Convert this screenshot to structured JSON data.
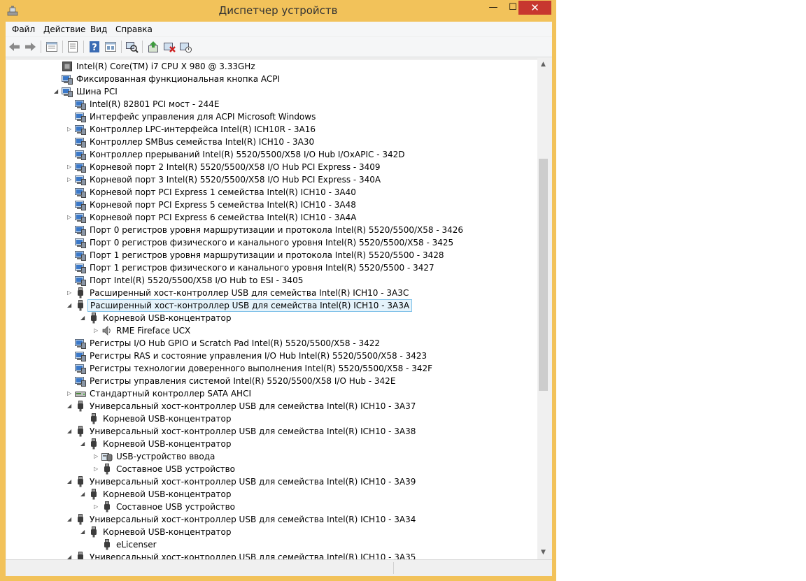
{
  "window": {
    "title": "Диспетчер устройств",
    "frame_color": "#f2c25a",
    "close_color": "#c7372f",
    "buttons": {
      "minimize": "—",
      "maximize": "☐",
      "close": "✕"
    }
  },
  "menu": [
    "Файл",
    "Действие",
    "Вид",
    "Справка"
  ],
  "toolbar": [
    "back-icon",
    "forward-icon",
    "properties-sheet-icon",
    "list-view-icon",
    "help-icon",
    "show-hidden-icon",
    "scan-hardware-icon",
    "update-driver-icon",
    "disable-device-icon",
    "uninstall-device-icon"
  ],
  "tree": [
    {
      "label": "Intel(R) Core(TM) i7 CPU       X 980  @ 3.33GHz",
      "level": 0,
      "expander": "none",
      "icon": "cpu"
    },
    {
      "label": "Фиксированная функциональная кнопка ACPI",
      "level": 0,
      "expander": "none",
      "icon": "system"
    },
    {
      "label": "Шина PCI",
      "level": 0,
      "expander": "open",
      "icon": "system"
    },
    {
      "label": "Intel(R) 82801 PCI мост - 244E",
      "level": 1,
      "expander": "none",
      "icon": "system"
    },
    {
      "label": "Интерфейс управления для ACPI Microsoft Windows",
      "level": 1,
      "expander": "none",
      "icon": "system"
    },
    {
      "label": "Контроллер LPC-интерфейса Intel(R) ICH10R - 3A16",
      "level": 1,
      "expander": "closed",
      "icon": "system"
    },
    {
      "label": "Контроллер SMBus семейства Intel(R) ICH10 - 3A30",
      "level": 1,
      "expander": "none",
      "icon": "system"
    },
    {
      "label": "Контроллер прерываний Intel(R) 5520/5500/X58 I/O Hub I/OxAPIC - 342D",
      "level": 1,
      "expander": "none",
      "icon": "system"
    },
    {
      "label": "Корневой порт 2 Intel(R) 5520/5500/X58 I/O Hub PCI Express - 3409",
      "level": 1,
      "expander": "closed",
      "icon": "system"
    },
    {
      "label": "Корневой порт 3 Intel(R) 5520/5500/X58 I/O Hub PCI Express - 340A",
      "level": 1,
      "expander": "closed",
      "icon": "system"
    },
    {
      "label": "Корневой порт PCI Express 1 семейства Intel(R) ICH10 - 3A40",
      "level": 1,
      "expander": "none",
      "icon": "system"
    },
    {
      "label": "Корневой порт PCI Express 5 семейства Intel(R) ICH10 - 3A48",
      "level": 1,
      "expander": "none",
      "icon": "system"
    },
    {
      "label": "Корневой порт PCI Express 6 семейства Intel(R) ICH10 - 3A4A",
      "level": 1,
      "expander": "closed",
      "icon": "system"
    },
    {
      "label": "Порт 0 регистров уровня маршрутизации и протокола Intel(R) 5520/5500/X58 - 3426",
      "level": 1,
      "expander": "none",
      "icon": "system"
    },
    {
      "label": "Порт 0 регистров физического и канального уровня Intel(R) 5520/5500/X58 - 3425",
      "level": 1,
      "expander": "none",
      "icon": "system"
    },
    {
      "label": "Порт 1 регистров уровня маршрутизации и протокола Intel(R) 5520/5500 - 3428",
      "level": 1,
      "expander": "none",
      "icon": "system"
    },
    {
      "label": "Порт 1 регистров физического и канального уровня Intel(R) 5520/5500 - 3427",
      "level": 1,
      "expander": "none",
      "icon": "system"
    },
    {
      "label": "Порт Intel(R) 5520/5500/X58 I/O Hub to ESI - 3405",
      "level": 1,
      "expander": "none",
      "icon": "system"
    },
    {
      "label": "Расширенный хост-контроллер USB для семейства Intel(R) ICH10 - 3A3C",
      "level": 1,
      "expander": "closed",
      "icon": "usb"
    },
    {
      "label": "Расширенный хост-контроллер USB для семейства Intel(R) ICH10 - 3A3A",
      "level": 1,
      "expander": "open",
      "icon": "usb",
      "selected": true
    },
    {
      "label": "Корневой USB-концентратор",
      "level": 2,
      "expander": "open",
      "icon": "usb"
    },
    {
      "label": "RME Fireface UCX",
      "level": 3,
      "expander": "closed",
      "icon": "speaker"
    },
    {
      "label": "Регистры I/O Hub GPIO и Scratch Pad Intel(R) 5520/5500/X58 - 3422",
      "level": 1,
      "expander": "none",
      "icon": "system"
    },
    {
      "label": "Регистры RAS и состояние управления I/O Hub Intel(R) 5520/5500/X58 - 3423",
      "level": 1,
      "expander": "none",
      "icon": "system"
    },
    {
      "label": "Регистры технологии доверенного выполнения Intel(R) 5520/5500/X58 - 342F",
      "level": 1,
      "expander": "none",
      "icon": "system"
    },
    {
      "label": "Регистры управления системой Intel(R) 5520/5500/X58 I/O Hub - 342E",
      "level": 1,
      "expander": "none",
      "icon": "system"
    },
    {
      "label": "Стандартный контроллер SATA AHCI",
      "level": 1,
      "expander": "closed",
      "icon": "storage"
    },
    {
      "label": "Универсальный хост-контроллер USB для семейства Intel(R) ICH10 - 3A37",
      "level": 1,
      "expander": "open",
      "icon": "usb"
    },
    {
      "label": "Корневой USB-концентратор",
      "level": 2,
      "expander": "none",
      "icon": "usb"
    },
    {
      "label": "Универсальный хост-контроллер USB для семейства Intel(R) ICH10 - 3A38",
      "level": 1,
      "expander": "open",
      "icon": "usb"
    },
    {
      "label": "Корневой USB-концентратор",
      "level": 2,
      "expander": "open",
      "icon": "usb"
    },
    {
      "label": "USB-устройство ввода",
      "level": 3,
      "expander": "closed",
      "icon": "hid"
    },
    {
      "label": "Составное USB устройство",
      "level": 3,
      "expander": "closed",
      "icon": "usb"
    },
    {
      "label": "Универсальный хост-контроллер USB для семейства Intel(R) ICH10 - 3A39",
      "level": 1,
      "expander": "open",
      "icon": "usb"
    },
    {
      "label": "Корневой USB-концентратор",
      "level": 2,
      "expander": "open",
      "icon": "usb"
    },
    {
      "label": "Составное USB устройство",
      "level": 3,
      "expander": "closed",
      "icon": "usb"
    },
    {
      "label": "Универсальный хост-контроллер USB для семейства Intel(R) ICH10 - 3A34",
      "level": 1,
      "expander": "open",
      "icon": "usb"
    },
    {
      "label": "Корневой USB-концентратор",
      "level": 2,
      "expander": "open",
      "icon": "usb"
    },
    {
      "label": "eLicenser",
      "level": 3,
      "expander": "none",
      "icon": "usb"
    },
    {
      "label": "Универсальный хост-контроллер USB для семейства Intel(R) ICH10 - 3A35",
      "level": 1,
      "expander": "open",
      "icon": "usb"
    }
  ],
  "scrollbar": {
    "up_arrow": "▲",
    "down_arrow": "▼"
  }
}
